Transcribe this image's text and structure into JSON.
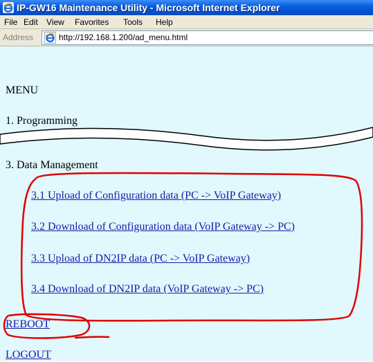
{
  "window": {
    "title": "IP-GW16 Maintenance Utility - Microsoft Internet Explorer",
    "icon": "ie-icon"
  },
  "menubar": {
    "items": [
      "File",
      "Edit",
      "View",
      "Favorites",
      "Tools",
      "Help"
    ]
  },
  "address": {
    "label": "Address",
    "url": "http://192.168.1.200/ad_menu.html"
  },
  "content": {
    "heading": "MENU",
    "section1": "1. Programming",
    "section3": "3. Data Management",
    "links": [
      "3.1 Upload of Configuration data (PC -> VoIP Gateway)",
      "3.2 Download of Configuration data (VoIP Gateway -> PC)",
      "3.3 Upload of DN2IP data (PC -> VoIP Gateway)",
      "3.4 Download of DN2IP data (VoIP Gateway -> PC)"
    ],
    "reboot": "REBOOT",
    "logout": "LOGOUT"
  },
  "colors": {
    "titlebar": "#0a5fe0",
    "background": "#e1f8fd",
    "link": "#1a1aa6",
    "annotation": "#e00000",
    "chrome": "#ece9d8"
  }
}
